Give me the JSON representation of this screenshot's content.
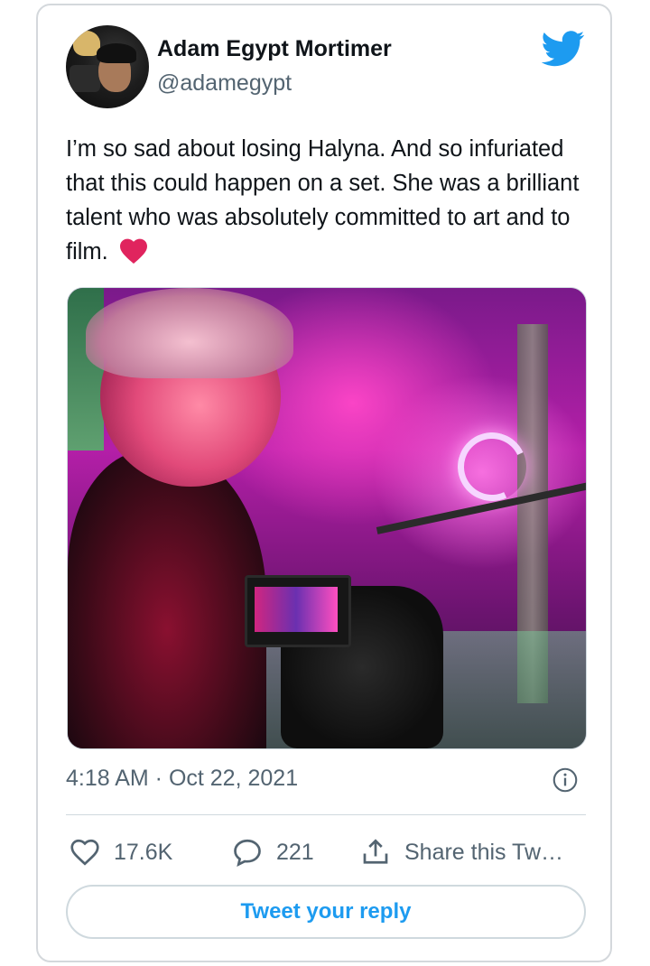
{
  "author": {
    "name": "Adam Egypt Mortimer",
    "handle": "@adamegypt"
  },
  "tweet": {
    "text": "I’m so sad about losing Halyna. And so infuriated that this could happen on a set. She was a brilliant talent who was absolutely committed to art and to film.",
    "emoji": "red-heart-emoji",
    "timestamp": "4:18 AM · Oct 22, 2021"
  },
  "actions": {
    "likes": "17.6K",
    "replies": "221",
    "share_label": "Share this Tw…"
  },
  "reply_button_label": "Tweet your reply",
  "colors": {
    "accent": "#1d9bf0",
    "heart": "#e0245e",
    "muted_text": "#536471",
    "border": "#cfd9de"
  },
  "icons": [
    "twitter-bird-icon",
    "info-icon",
    "heart-icon",
    "reply-bubble-icon",
    "share-icon"
  ]
}
